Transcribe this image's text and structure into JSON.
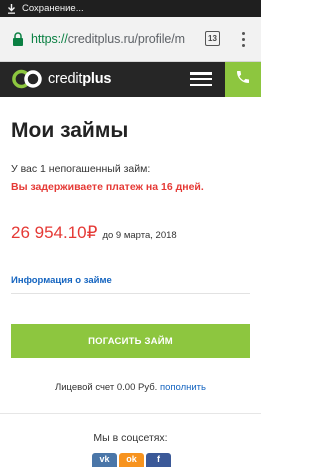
{
  "status_bar": {
    "text": "Сохранение...",
    "icon": "download-icon"
  },
  "browser": {
    "url_scheme": "https://",
    "url_rest": "creditplus.ru/profile/m",
    "tabs_count": "13",
    "lock_icon": "lock-icon",
    "menu_icon": "more-vert-icon"
  },
  "header": {
    "logo_bold": "credit",
    "logo_rest": "plus",
    "menu_icon": "hamburger-icon",
    "phone_icon": "phone-icon"
  },
  "main": {
    "title": "Мои займы",
    "loans_count_text": "У вас 1 непогашенный займ:",
    "overdue_text": "Вы задерживаете платеж на 16 дней.",
    "amount": "26 954.10₽",
    "due_text": "до 9 марта, 2018",
    "loan_info_link": "Информация о займе",
    "pay_button": "ПОГАСИТЬ ЗАЙМ",
    "account_text": "Лицевой счет 0.00 Руб.",
    "topup_link": "пополнить"
  },
  "footer": {
    "social_label": "Мы в соцсетях:",
    "social": [
      {
        "name": "vk",
        "color": "#4a76a8",
        "glyph": "vk"
      },
      {
        "name": "odnoklassniki",
        "color": "#f7931e",
        "glyph": "ok"
      },
      {
        "name": "facebook",
        "color": "#3b5998",
        "glyph": "f"
      }
    ]
  },
  "colors": {
    "brand_green": "#8dc63f",
    "alert_red": "#e53935",
    "link_blue": "#1565c0",
    "header_dark": "#262626"
  }
}
